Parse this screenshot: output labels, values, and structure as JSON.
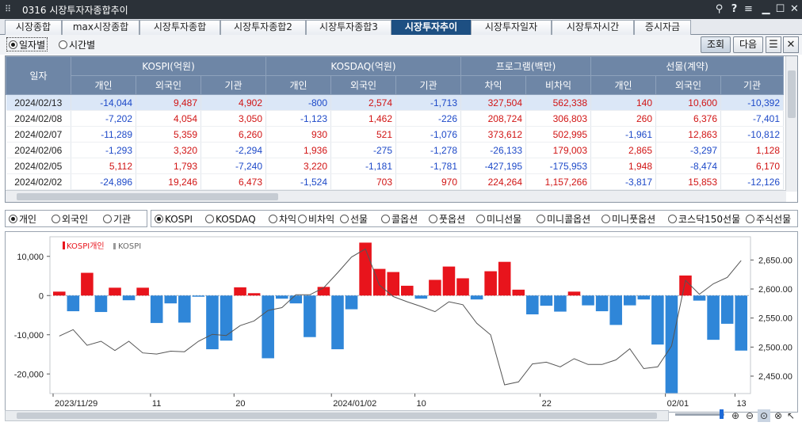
{
  "window": {
    "title": "0316 시장투자자종합추이",
    "controls": {
      "pin": "pin-icon",
      "help": "?",
      "menu": "menu-icon",
      "minimize": "minimize-icon",
      "maximize": "maximize-icon",
      "close": "close-icon"
    }
  },
  "tabs": [
    {
      "label": "시장종합",
      "active": false
    },
    {
      "label": "max시장종합",
      "active": false
    },
    {
      "label": "시장투자종합",
      "active": false
    },
    {
      "label": "시장투자종합2",
      "active": false
    },
    {
      "label": "시장투자종합3",
      "active": false
    },
    {
      "label": "시장투자추이",
      "active": true
    },
    {
      "label": "시장투자일자",
      "active": false
    },
    {
      "label": "시장투자시간",
      "active": false
    },
    {
      "label": "증시자금",
      "active": false
    }
  ],
  "options": {
    "by_date": "일자별",
    "by_time": "시간별",
    "query_button": "조회",
    "next_button": "다음"
  },
  "grid": {
    "date_header": "일자",
    "groups": [
      "KOSPI(억원)",
      "KOSDAQ(억원)",
      "프로그램(백만)",
      "선물(계약)"
    ],
    "subheaders": [
      "개인",
      "외국인",
      "기관",
      "개인",
      "외국인",
      "기관",
      "차익",
      "비차익",
      "개인",
      "외국인",
      "기관"
    ],
    "rows": [
      {
        "date": "2024/02/13",
        "values": [
          "-14,044",
          "9,487",
          "4,902",
          "-800",
          "2,574",
          "-1,713",
          "327,504",
          "562,338",
          "140",
          "10,600",
          "-10,392"
        ]
      },
      {
        "date": "2024/02/08",
        "values": [
          "-7,202",
          "4,054",
          "3,050",
          "-1,123",
          "1,462",
          "-226",
          "208,724",
          "306,803",
          "260",
          "6,376",
          "-7,401"
        ]
      },
      {
        "date": "2024/02/07",
        "values": [
          "-11,289",
          "5,359",
          "6,260",
          "930",
          "521",
          "-1,076",
          "373,612",
          "502,995",
          "-1,961",
          "12,863",
          "-10,812"
        ]
      },
      {
        "date": "2024/02/06",
        "values": [
          "-1,293",
          "3,320",
          "-2,294",
          "1,936",
          "-275",
          "-1,278",
          "-26,133",
          "179,003",
          "2,865",
          "-3,297",
          "1,128"
        ]
      },
      {
        "date": "2024/02/05",
        "values": [
          "5,112",
          "1,793",
          "-7,240",
          "3,220",
          "-1,181",
          "-1,781",
          "-427,195",
          "-175,953",
          "1,948",
          "-8,474",
          "6,170"
        ]
      },
      {
        "date": "2024/02/02",
        "values": [
          "-24,896",
          "19,246",
          "6,473",
          "-1,524",
          "703",
          "970",
          "224,264",
          "1,157,266",
          "-3,817",
          "15,853",
          "-12,126"
        ]
      }
    ]
  },
  "investor_filter": [
    {
      "label": "개인",
      "checked": true
    },
    {
      "label": "외국인",
      "checked": false
    },
    {
      "label": "기관",
      "checked": false
    }
  ],
  "market_filter": [
    {
      "label": "KOSPI",
      "checked": true
    },
    {
      "label": "KOSDAQ",
      "checked": false
    },
    {
      "label": "차익",
      "checked": false
    },
    {
      "label": "비차익",
      "checked": false
    },
    {
      "label": "선물",
      "checked": false
    },
    {
      "label": "콜옵션",
      "checked": false
    },
    {
      "label": "풋옵션",
      "checked": false
    },
    {
      "label": "미니선물",
      "checked": false
    },
    {
      "label": "미니콜옵션",
      "checked": false
    },
    {
      "label": "미니풋옵션",
      "checked": false
    },
    {
      "label": "코스닥150선물",
      "checked": false
    },
    {
      "label": "주식선물",
      "checked": false
    }
  ],
  "colors": {
    "positive": "#d11414",
    "negative": "#1d49c8",
    "bar_positive": "#e8141c",
    "bar_negative": "#2f86d8",
    "line": "#555555",
    "header": "#6e86a6",
    "active_tab": "#1d4f82",
    "titlebar": "#2b3138"
  },
  "chart_data": {
    "type": "bar",
    "legend": [
      "KOSPI개인",
      "KOSPI"
    ],
    "legend_position": "top-left",
    "grid": false,
    "x_tick_labels": [
      "2023/11/29",
      "11",
      "20",
      "2024/01/02",
      "10",
      "22",
      "02/01",
      "13"
    ],
    "ylim_left": [
      -25000,
      15000
    ],
    "yticks_left": [
      "10,000",
      "0",
      "-10,000",
      "-20,000"
    ],
    "ylim_right": [
      2420,
      2690
    ],
    "yticks_right": [
      "2,650.00",
      "2,600.00",
      "2,550.00",
      "2,500.00",
      "2,450.00"
    ],
    "series": [
      {
        "name": "KOSPI개인",
        "type": "bar",
        "values": [
          1000,
          -4000,
          5800,
          -4200,
          2000,
          -1200,
          2000,
          -7000,
          -2000,
          -6900,
          -300,
          -13700,
          -11500,
          2100,
          600,
          -16000,
          -800,
          -2000,
          -10600,
          2200,
          -13700,
          -3500,
          13500,
          6800,
          6000,
          2500,
          -800,
          4000,
          7400,
          4400,
          -1000,
          6200,
          8600,
          1500,
          -4800,
          -2600,
          -4100,
          1000,
          -2500,
          -4000,
          -7500,
          -2500,
          -1000,
          -12500,
          -24896,
          5112,
          -1293,
          -11289,
          -7202,
          -14044
        ]
      },
      {
        "name": "KOSPI",
        "type": "line",
        "values": [
          2519,
          2530,
          2503,
          2510,
          2494,
          2510,
          2490,
          2488,
          2493,
          2492,
          2510,
          2522,
          2520,
          2537,
          2545,
          2563,
          2568,
          2590,
          2590,
          2602,
          2628,
          2655,
          2669,
          2607,
          2587,
          2578,
          2570,
          2561,
          2578,
          2573,
          2541,
          2521,
          2435,
          2440,
          2471,
          2474,
          2466,
          2480,
          2470,
          2470,
          2478,
          2497,
          2463,
          2466,
          2502,
          2615,
          2591,
          2609,
          2620,
          2649
        ]
      }
    ]
  }
}
